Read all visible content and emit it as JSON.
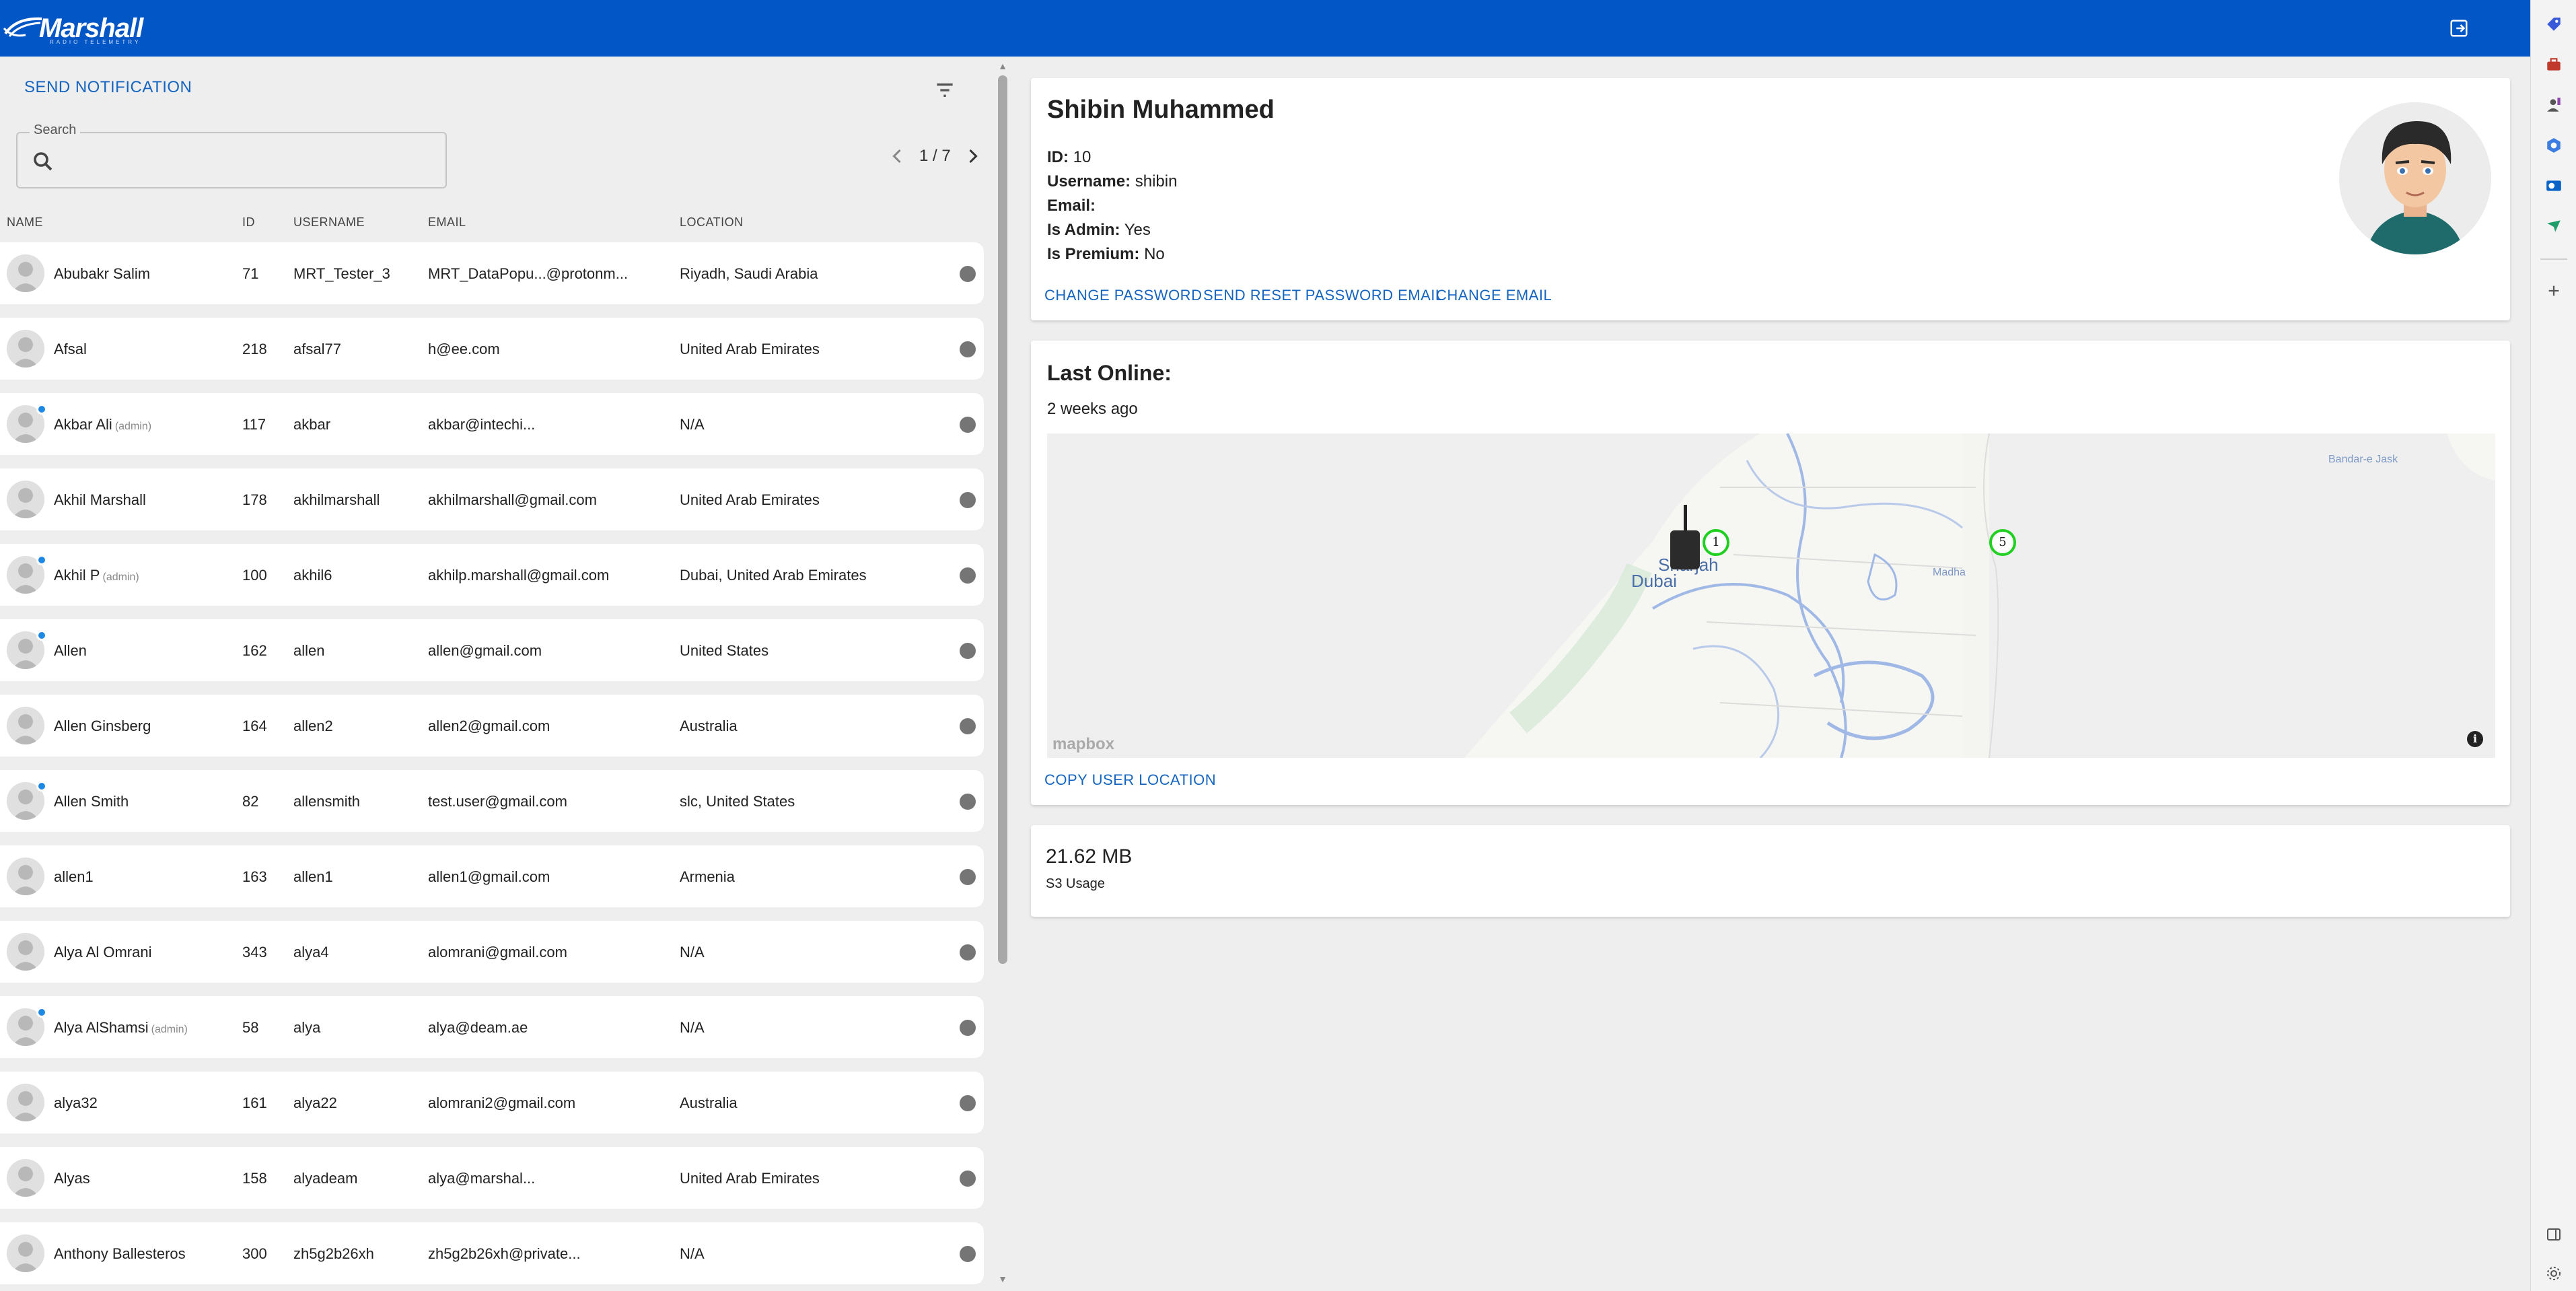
{
  "header": {
    "logo_text": "Marshall",
    "logo_subtitle": "RADIO TELEMETRY",
    "brand_color": "#0356c6",
    "logout_icon": "logout-icon"
  },
  "browser_rail": {
    "icons": [
      "tag-icon",
      "toolbox-icon",
      "person-icon",
      "copilot-icon",
      "outlook-icon",
      "bolt-icon",
      "add-icon",
      "sidebar-toggle-icon",
      "settings-icon"
    ]
  },
  "users_panel": {
    "send_notification_label": "SEND NOTIFICATION",
    "filter_icon": "filter-icon",
    "search": {
      "label": "Search",
      "value": "",
      "placeholder": ""
    },
    "pagination": {
      "text": "1 / 7"
    },
    "columns": {
      "name": "NAME",
      "id": "ID",
      "username": "USERNAME",
      "email": "EMAIL",
      "location": "LOCATION"
    },
    "rows": [
      {
        "name": "Abubakr Salim",
        "admin": false,
        "badge": false,
        "id": "71",
        "username": "MRT_Tester_3",
        "email": "MRT_DataPopu...@protonm...",
        "location": "Riyadh, Saudi Arabia"
      },
      {
        "name": "Afsal",
        "admin": false,
        "badge": false,
        "id": "218",
        "username": "afsal77",
        "email": "h@ee.com",
        "location": "United Arab Emirates"
      },
      {
        "name": "Akbar Ali",
        "admin": true,
        "badge": true,
        "id": "117",
        "username": "akbar",
        "email": "akbar@intechi...",
        "location": "N/A"
      },
      {
        "name": "Akhil Marshall",
        "admin": false,
        "badge": false,
        "id": "178",
        "username": "akhilmarshall",
        "email": "akhilmarshall@gmail.com",
        "location": "United Arab Emirates"
      },
      {
        "name": "Akhil P",
        "admin": true,
        "badge": true,
        "id": "100",
        "username": "akhil6",
        "email": "akhilp.marshall@gmail.com",
        "location": "Dubai, United Arab Emirates"
      },
      {
        "name": "Allen",
        "admin": false,
        "badge": true,
        "id": "162",
        "username": "allen",
        "email": "allen@gmail.com",
        "location": "United States"
      },
      {
        "name": "Allen Ginsberg",
        "admin": false,
        "badge": false,
        "id": "164",
        "username": "allen2",
        "email": "allen2@gmail.com",
        "location": "Australia"
      },
      {
        "name": "Allen Smith",
        "admin": false,
        "badge": true,
        "id": "82",
        "username": "allensmith",
        "email": "test.user@gmail.com",
        "location": "slc, United States"
      },
      {
        "name": "allen1",
        "admin": false,
        "badge": false,
        "id": "163",
        "username": "allen1",
        "email": "allen1@gmail.com",
        "location": "Armenia"
      },
      {
        "name": "Alya Al Omrani",
        "admin": false,
        "badge": false,
        "id": "343",
        "username": "alya4",
        "email": "alomrani@gmail.com",
        "location": "N/A"
      },
      {
        "name": "Alya AlShamsi",
        "admin": true,
        "badge": true,
        "id": "58",
        "username": "alya",
        "email": "alya@deam.ae",
        "location": "N/A"
      },
      {
        "name": "alya32",
        "admin": false,
        "badge": false,
        "id": "161",
        "username": "alya22",
        "email": "alomrani2@gmail.com",
        "location": "Australia"
      },
      {
        "name": "Alyas",
        "admin": false,
        "badge": false,
        "id": "158",
        "username": "alyadeam",
        "email": "alya@marshal...",
        "location": "United Arab Emirates"
      },
      {
        "name": "Anthony Ballesteros",
        "admin": false,
        "badge": false,
        "id": "300",
        "username": "zh5g2b26xh",
        "email": "zh5g2b26xh@private...",
        "location": "N/A"
      }
    ],
    "admin_tag": "(admin)",
    "status_color": "#757575"
  },
  "profile": {
    "name": "Shibin Muhammed",
    "fields": [
      {
        "label": "ID:",
        "value": "10"
      },
      {
        "label": "Username:",
        "value": "shibin"
      },
      {
        "label": "Email:",
        "value": ""
      },
      {
        "label": "Is Admin:",
        "value": "Yes"
      },
      {
        "label": "Is Premium:",
        "value": "No"
      }
    ],
    "actions": {
      "change_password": "CHANGE PASSWORD",
      "send_reset": "SEND RESET PASSWORD EMAIL",
      "change_email": "CHANGE EMAIL"
    }
  },
  "last_online": {
    "title": "Last Online:",
    "value": "2 weeks ago",
    "map": {
      "labels": {
        "dubai": "Dubai",
        "sharjah": "Sharjah",
        "madha": "Madha",
        "bandar": "Bandar-e Jask"
      },
      "clusters": [
        "1",
        "5"
      ],
      "attribution": "mapbox",
      "info": "i"
    },
    "copy_location": "COPY USER LOCATION"
  },
  "storage": {
    "value": "21.62 MB",
    "label": "S3 Usage"
  }
}
